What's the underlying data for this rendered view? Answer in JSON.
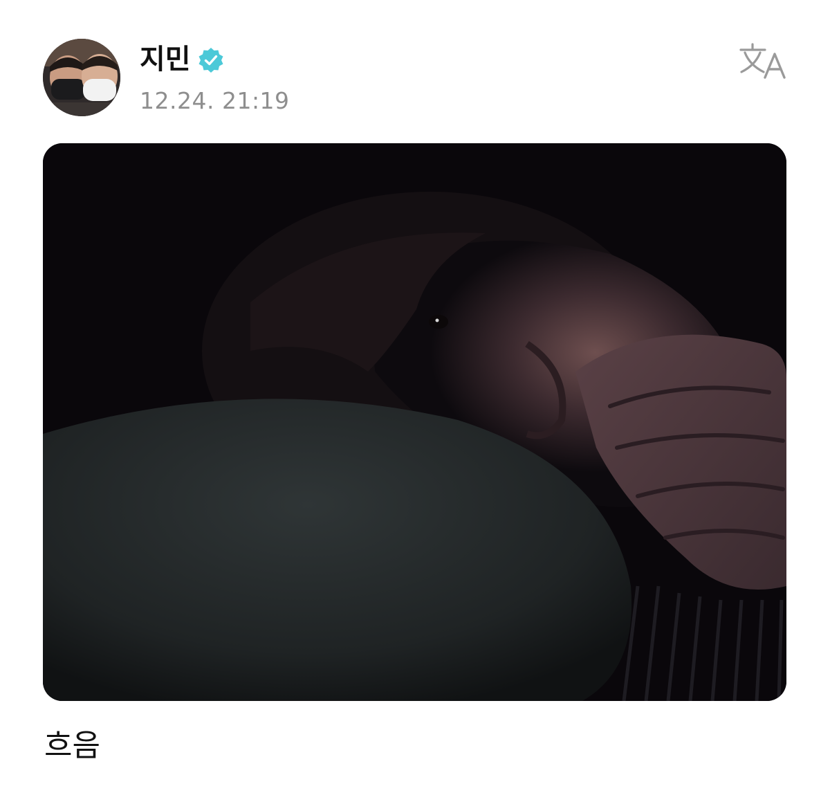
{
  "post": {
    "author": {
      "name": "지민",
      "verified": true,
      "avatar_icon": "profile-photo-two-people-masks"
    },
    "timestamp": "12.24. 21:19",
    "translate_icon": "translate-icon",
    "photo": {
      "description_icon": "photo-dark-selfie"
    },
    "caption": "흐음"
  },
  "colors": {
    "verified_badge": "#4cc9d8",
    "timestamp_text": "#8e8e8e",
    "name_text": "#111111",
    "translate_icon": "#9a9a9a"
  }
}
